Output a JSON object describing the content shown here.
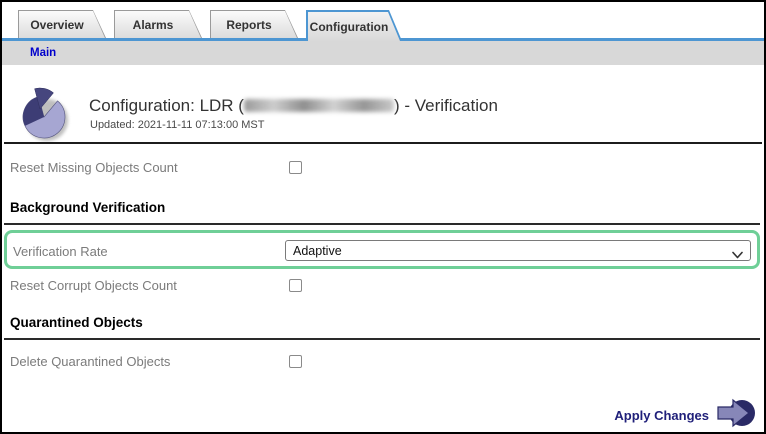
{
  "tabs": [
    {
      "label": "Overview",
      "active": false
    },
    {
      "label": "Alarms",
      "active": false
    },
    {
      "label": "Reports",
      "active": false
    },
    {
      "label": "Configuration",
      "active": true
    }
  ],
  "breadcrumb": {
    "main_label": "Main"
  },
  "header": {
    "title_prefix": "Configuration: LDR (",
    "title_suffix": ") - Verification",
    "updated": "Updated: 2021-11-11 07:13:00 MST"
  },
  "form": {
    "reset_missing_label": "Reset Missing Objects Count",
    "section_background_verification": "Background Verification",
    "verification_rate_label": "Verification Rate",
    "verification_rate_value": "Adaptive",
    "reset_corrupt_label": "Reset Corrupt Objects Count",
    "section_quarantined_objects": "Quarantined Objects",
    "delete_quarantined_label": "Delete Quarantined Objects"
  },
  "apply": {
    "label": "Apply Changes"
  },
  "colors": {
    "tab_blue": "#4d96d2",
    "link_blue": "#0000cc",
    "highlight_green": "#6fcf97",
    "navy": "#20207a",
    "label_gray": "#7b7b7b",
    "pie_light": "#a6a6d2",
    "pie_dark": "#3d3d75"
  }
}
